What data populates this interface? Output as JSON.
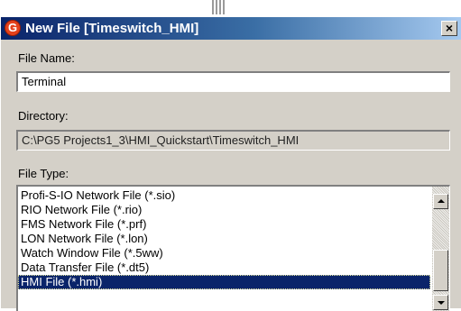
{
  "dialog": {
    "title": "New File [Timeswitch_HMI]",
    "app_icon_glyph": "G",
    "close_glyph": "×"
  },
  "form": {
    "file_name_label": "File Name:",
    "file_name_value": "Terminal",
    "directory_label": "Directory:",
    "directory_value": "C:\\PG5 Projects1_3\\HMI_Quickstart\\Timeswitch_HMI",
    "file_type_label": "File Type:"
  },
  "file_types": {
    "items": [
      "Profi-S-IO Network File (*.sio)",
      "RIO Network File (*.rio)",
      "FMS Network File (*.prf)",
      "LON Network File (*.lon)",
      "Watch Window File (*.5ww)",
      "Data Transfer File (*.dt5)",
      "HMI File (*.hmi)"
    ],
    "selected": "HMI File (*.hmi)"
  },
  "colors": {
    "titlebar_start": "#0a246a",
    "titlebar_end": "#a6caf0",
    "dialog_face": "#d4d0c8",
    "selection": "#0a246a",
    "app_icon": "#e4411b"
  }
}
